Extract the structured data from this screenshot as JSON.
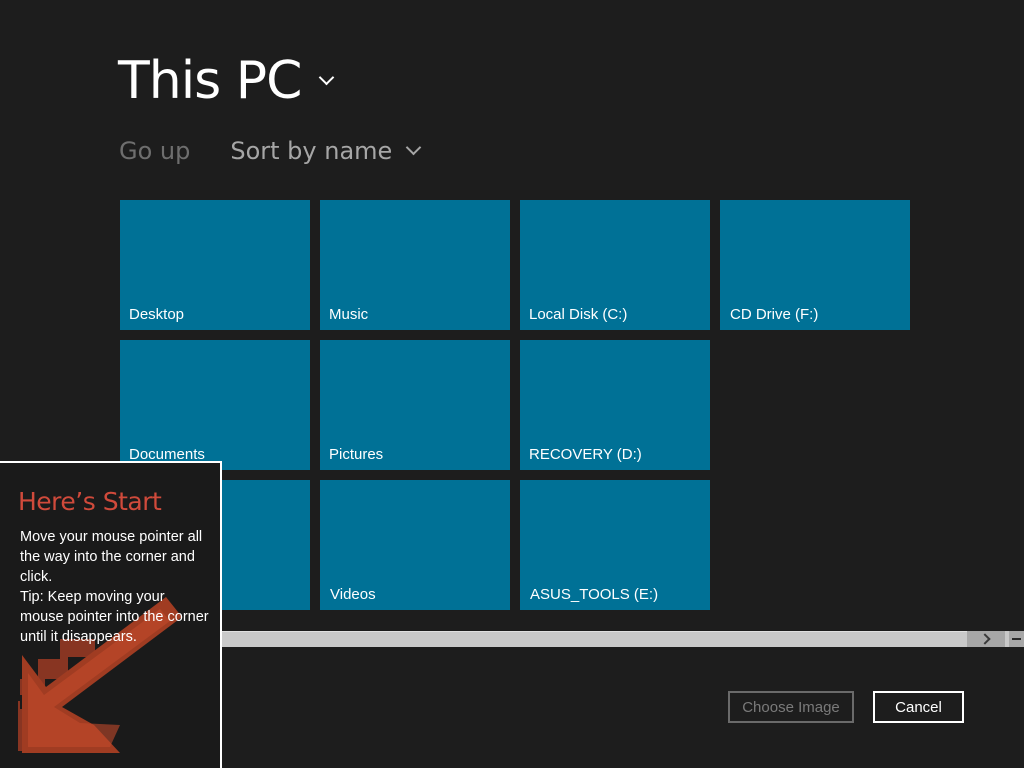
{
  "location": {
    "title": "This PC"
  },
  "toolbar": {
    "go_up": "Go up",
    "sort": "Sort by name"
  },
  "tiles": [
    {
      "label": "Desktop"
    },
    {
      "label": "Music"
    },
    {
      "label": "Local Disk (C:)"
    },
    {
      "label": "CD Drive (F:)"
    },
    {
      "label": "Documents"
    },
    {
      "label": "Pictures"
    },
    {
      "label": "RECOVERY (D:)"
    },
    {
      "label": ""
    },
    {
      "label": "Videos"
    },
    {
      "label": "ASUS_TOOLS (E:)"
    }
  ],
  "buttons": {
    "choose_image": "Choose Image",
    "cancel": "Cancel"
  },
  "start_tip": {
    "title": "Here’s Start",
    "line1": "Move your mouse pointer all the way into the corner and click.",
    "line2": "Tip: Keep moving your mouse pointer into the corner until it disappears."
  },
  "colors": {
    "tile": "#007196",
    "background": "#1d1d1d",
    "tip_title": "#d04a3b",
    "tip_arrow": "#9c3a24"
  },
  "icons": {
    "location_dropdown": "chevron-down-icon",
    "sort_dropdown": "chevron-down-icon",
    "scroll_right": "chevron-right-icon",
    "scroll_end": "minus-icon",
    "tip_arrow": "arrow-down-left-icon"
  }
}
